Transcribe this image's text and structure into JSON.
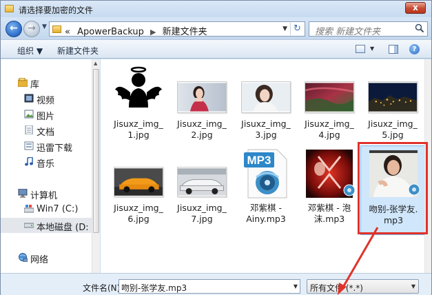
{
  "window": {
    "title": "请选择要加密的文件",
    "close_label": "x"
  },
  "address_bar": {
    "prefix": "«",
    "breadcrumbs": [
      "ApowerBackup",
      "新建文件夹"
    ],
    "search_placeholder": "搜索 新建文件夹"
  },
  "toolbar": {
    "organize_label": "组织 ▼",
    "new_folder_label": "新建文件夹"
  },
  "nav_pane": {
    "items": [
      {
        "label": "库",
        "icon": "library-icon"
      },
      {
        "label": "视频",
        "icon": "video-icon"
      },
      {
        "label": "图片",
        "icon": "pictures-icon"
      },
      {
        "label": "文档",
        "icon": "documents-icon"
      },
      {
        "label": "迅雷下载",
        "icon": "download-icon"
      },
      {
        "label": "音乐",
        "icon": "music-icon"
      },
      {
        "label": "计算机",
        "icon": "computer-icon"
      },
      {
        "label": "Win7 (C:)",
        "icon": "drive-icon"
      },
      {
        "label": "本地磁盘 (D:",
        "icon": "drive-icon"
      },
      {
        "label": "网络",
        "icon": "network-icon"
      }
    ]
  },
  "files": [
    {
      "line1": "Jisuxz_img_",
      "line2": "1.jpg"
    },
    {
      "line1": "Jisuxz_img_",
      "line2": "2.jpg"
    },
    {
      "line1": "Jisuxz_img_",
      "line2": "3.jpg"
    },
    {
      "line1": "Jisuxz_img_",
      "line2": "4.jpg"
    },
    {
      "line1": "Jisuxz_img_",
      "line2": "5.jpg"
    },
    {
      "line1": "Jisuxz_img_",
      "line2": "6.jpg"
    },
    {
      "line1": "Jisuxz_img_",
      "line2": "7.jpg"
    },
    {
      "line1": "邓紫棋 -",
      "line2": "Ainy.mp3"
    },
    {
      "line1": "邓紫棋 - 泡",
      "line2": "沫.mp3"
    },
    {
      "line1": "吻别-张学友.",
      "line2": "mp3"
    }
  ],
  "mp3_icon_text": "MP3",
  "bottom": {
    "filename_label": "文件名(N):",
    "filename_value": "吻别-张学友.mp3",
    "filetype_value": "所有文件 (*.*)"
  },
  "colors": {
    "highlight": "#e0322a",
    "selection": "#cfe6fb"
  }
}
